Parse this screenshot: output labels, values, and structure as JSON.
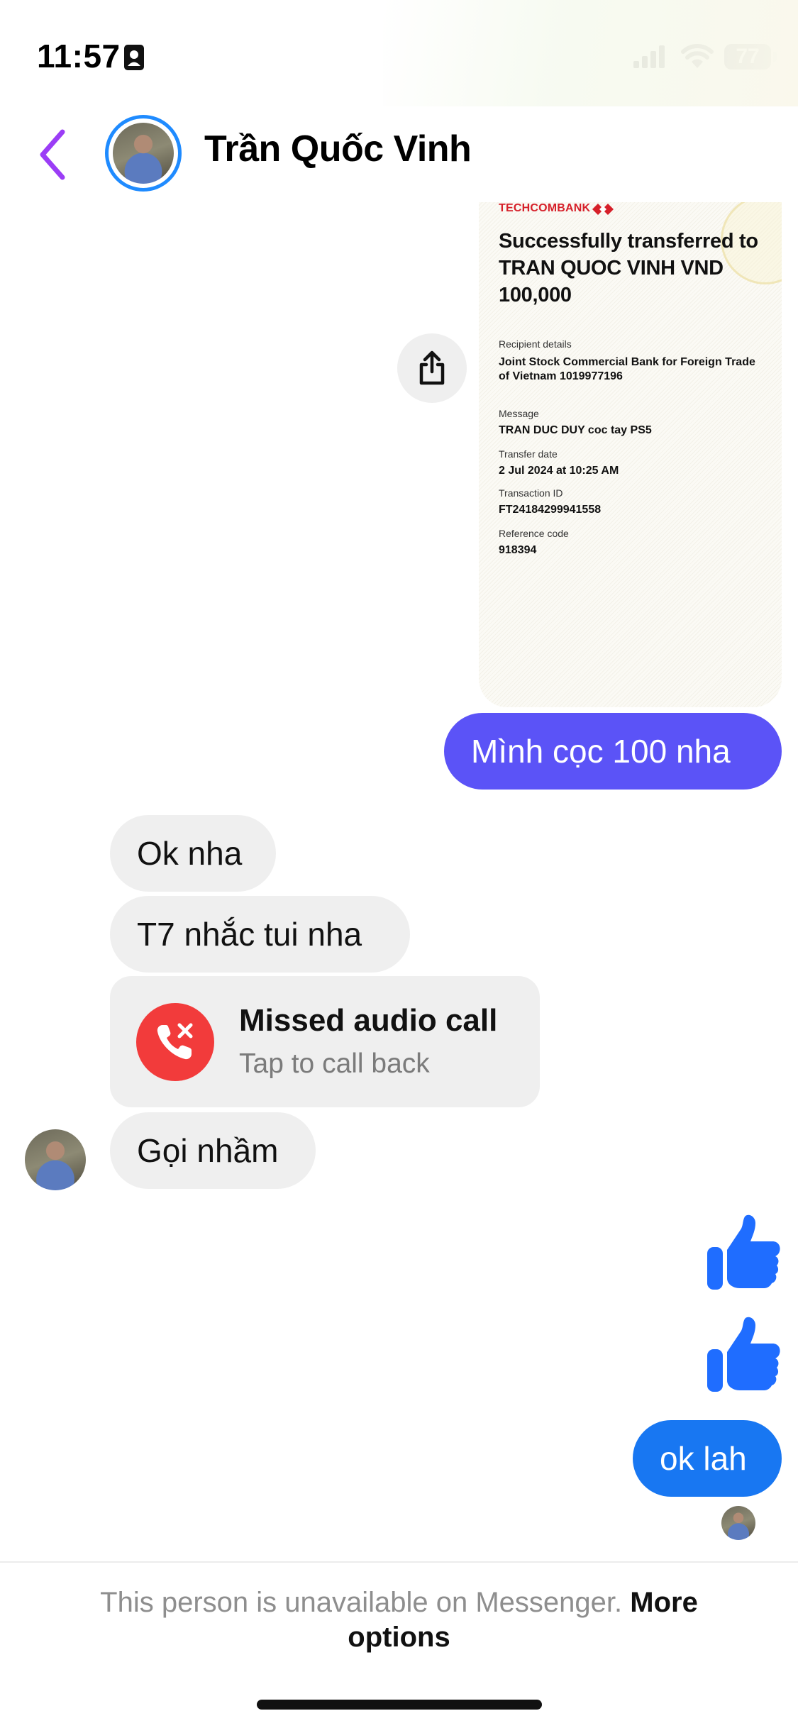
{
  "status_bar": {
    "time": "11:57",
    "battery": "77",
    "icons": [
      "id-card-icon",
      "cellular-signal-icon",
      "wifi-icon",
      "battery-icon"
    ]
  },
  "header": {
    "contact_name": "Trần Quốc Vinh",
    "back_icon": "chevron-left-icon",
    "accent_color": "#9b3df6"
  },
  "receipt": {
    "bank_name": "TECHCOMBANK",
    "title": "Successfully transferred to TRAN QUOC VINH VND 100,000",
    "recipient_label": "Recipient details",
    "recipient_value": "Joint Stock Commercial Bank for Foreign Trade of Vietnam 1019977196",
    "message_label": "Message",
    "message_value": "TRAN DUC DUY coc tay PS5",
    "date_label": "Transfer date",
    "date_value": "2 Jul 2024 at 10:25 AM",
    "txn_label": "Transaction ID",
    "txn_value": "FT24184299941558",
    "ref_label": "Reference code",
    "ref_value": "918394"
  },
  "messages": {
    "sent_1": "Mình cọc 100 nha",
    "recv_1": "Ok nha",
    "recv_2": "T7 nhắc tui nha",
    "missed_call_title": "Missed audio call",
    "missed_call_sub": "Tap to call back",
    "recv_3": "Gọi nhầm",
    "sent_2": "ok lah"
  },
  "footer": {
    "notice": "This person is unavailable on Messenger.",
    "more_options": "More options"
  },
  "colors": {
    "purple_bubble": "#5b53f7",
    "blue_bubble": "#1877f2",
    "incoming_bubble": "#efefef",
    "missed_call_red": "#f23b3b",
    "avatar_ring": "#1f8bff"
  }
}
